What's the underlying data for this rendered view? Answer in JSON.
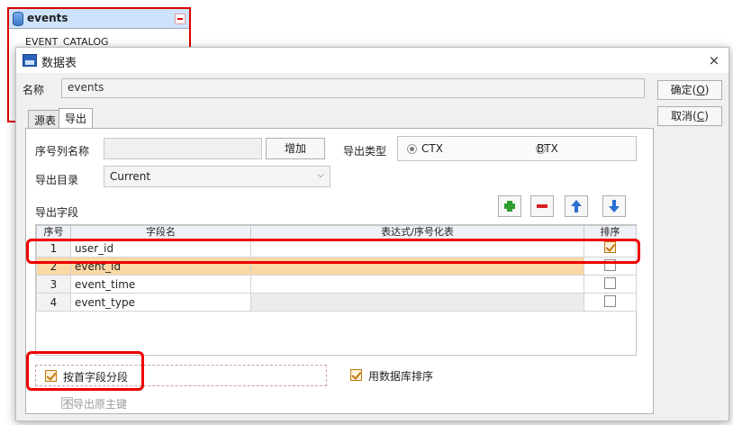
{
  "background_widget": {
    "title": "events",
    "row_text": "EVENT_CATALOG"
  },
  "dialog": {
    "title": "数据表",
    "close_glyph": "×",
    "name_label": "名称",
    "name_value": "events",
    "ok_label": "确定(",
    "ok_key": "O",
    "ok_suffix": ")",
    "cancel_label": "取消(",
    "cancel_key": "C",
    "cancel_suffix": ")"
  },
  "tabs": [
    {
      "label": "源表",
      "active": false
    },
    {
      "label": "导出",
      "active": true
    }
  ],
  "export": {
    "seq_col_label": "序号列名称",
    "seq_col_value": "",
    "add_label": "增加",
    "export_type_label": "导出类型",
    "type_options": [
      {
        "label": "CTX",
        "selected": true
      },
      {
        "label": "BTX",
        "selected": false
      }
    ],
    "dir_label": "导出目录",
    "dir_value": "Current",
    "fields_label": "导出字段"
  },
  "toolbar_icons": [
    "add-icon",
    "remove-icon",
    "arrow-up-icon",
    "arrow-down-icon"
  ],
  "grid": {
    "columns": [
      "序号",
      "字段名",
      "表达式/序号化表",
      "排序"
    ],
    "rows": [
      {
        "num": "1",
        "field": "user_id",
        "expr": "",
        "sort": true
      },
      {
        "num": "2",
        "field": "event_id",
        "expr": "",
        "sort": false
      },
      {
        "num": "3",
        "field": "event_time",
        "expr": "",
        "sort": false
      },
      {
        "num": "4",
        "field": "event_type",
        "expr": "",
        "sort": false
      }
    ],
    "selected_row_index": 1
  },
  "options": {
    "segment_by_first_field_label": "按首字段分段",
    "segment_by_first_field_checked": true,
    "db_sort_label": "用数据库排序",
    "db_sort_checked": true,
    "no_export_pk_label": "不导出原主键",
    "no_export_pk_checked": false
  },
  "colors": {
    "highlight": "#e00000",
    "selected_row": "#fbd8a6",
    "add_icon": "#2e9e2e",
    "remove_icon": "#d42020",
    "arrow_icon": "#2a6fd1"
  }
}
